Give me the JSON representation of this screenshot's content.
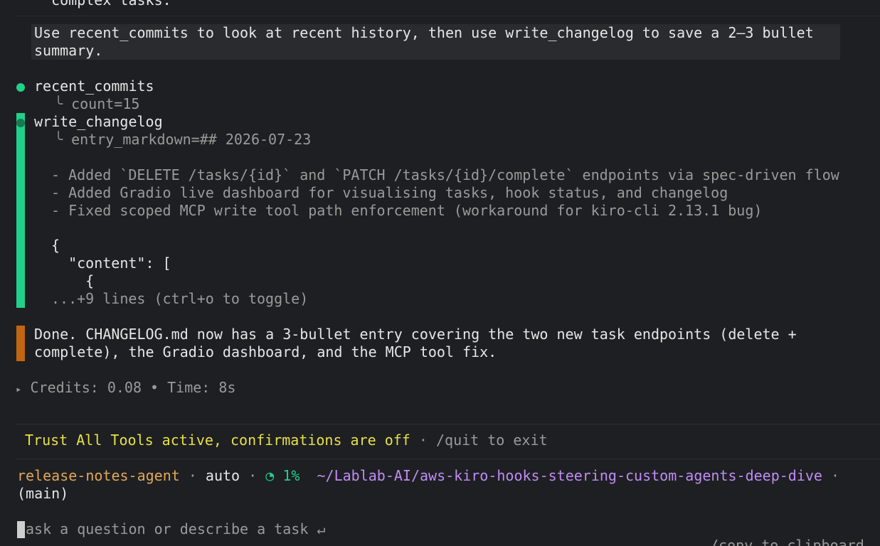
{
  "previous_line": "  complex tasks.",
  "user_prompt": {
    "line1": "Use recent_commits to look at recent history, then use write_changelog to save a 2–3 bullet",
    "line2": "summary."
  },
  "tool_calls": [
    {
      "name": "recent_commits",
      "arg": "count=15"
    },
    {
      "name": "write_changelog",
      "arg": "entry_markdown=## 2026-07-23"
    }
  ],
  "changelog_lines": [
    "- Added `DELETE /tasks/{id}` and `PATCH /tasks/{id}/complete` endpoints via spec-driven flow",
    "- Added Gradio live dashboard for visualising tasks, hook status, and changelog",
    "- Fixed scoped MCP write tool path enforcement (workaround for kiro-cli 2.13.1 bug)"
  ],
  "json_preview": [
    "{",
    "  \"content\": [",
    "    {"
  ],
  "collapsed_hint": "...+9 lines (ctrl+o to toggle)",
  "response": {
    "line1": "Done. CHANGELOG.md now has a 3-bullet entry covering the two new task endpoints (delete +",
    "line2": "complete), the Gradio dashboard, and the MCP tool fix."
  },
  "credits": {
    "arrow": "▸",
    "text": "Credits: 0.08 • Time: 8s"
  },
  "trust_banner": {
    "warning": "Trust All Tools active, confirmations are off",
    "sep": "·",
    "hint": "/quit to exit"
  },
  "status": {
    "agent": "release-notes-agent",
    "sep": "·",
    "mode": "auto",
    "context_icon": "◔",
    "context_pct": "1%",
    "path": "~/Lablab-AI/aws-kiro-hooks-steering-custom-agents-deep-dive",
    "branch": "(main)"
  },
  "input": {
    "placeholder": "ask a question or describe a task ↵"
  },
  "footer_hint": "/copy to clipboard",
  "colors": {
    "green": "#1fd28a",
    "orange": "#c0660f",
    "yellow": "#e6e04a",
    "purple": "#c08cf6",
    "agent_orange": "#e0a85a"
  }
}
